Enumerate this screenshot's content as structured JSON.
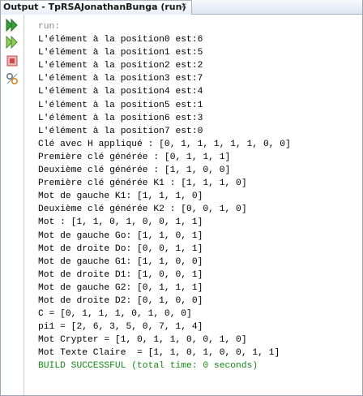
{
  "window": {
    "tab_title": "Output - TpRSAJonathanBunga (run)",
    "close_glyph": "×"
  },
  "toolbar": {
    "icons": [
      "rerun-icon",
      "rerun-with-options-icon",
      "stop-icon",
      "settings-icon"
    ],
    "colors": {
      "rerun": "#3aa23a",
      "stop": "#c94a4a"
    }
  },
  "console": {
    "lines": [
      {
        "text": "run:",
        "kind": "run"
      },
      {
        "text": "L'élément à la position0 est:6",
        "kind": "normal"
      },
      {
        "text": "L'élément à la position1 est:5",
        "kind": "normal"
      },
      {
        "text": "L'élément à la position2 est:2",
        "kind": "normal"
      },
      {
        "text": "L'élément à la position3 est:7",
        "kind": "normal"
      },
      {
        "text": "L'élément à la position4 est:4",
        "kind": "normal"
      },
      {
        "text": "L'élément à la position5 est:1",
        "kind": "normal"
      },
      {
        "text": "L'élément à la position6 est:3",
        "kind": "normal"
      },
      {
        "text": "L'élément à la position7 est:0",
        "kind": "normal"
      },
      {
        "text": "Clé avec H appliqué : [0, 1, 1, 1, 1, 1, 0, 0]",
        "kind": "normal"
      },
      {
        "text": "Première clé générée : [0, 1, 1, 1]",
        "kind": "normal"
      },
      {
        "text": "Deuxième clé générée : [1, 1, 0, 0]",
        "kind": "normal"
      },
      {
        "text": "Première clé générée K1 : [1, 1, 1, 0]",
        "kind": "normal"
      },
      {
        "text": "Mot de gauche K1: [1, 1, 1, 0]",
        "kind": "normal"
      },
      {
        "text": "Deuxième clé générée K2 : [0, 0, 1, 0]",
        "kind": "normal"
      },
      {
        "text": "Mot : [1, 1, 0, 1, 0, 0, 1, 1]",
        "kind": "normal"
      },
      {
        "text": "Mot de gauche Go: [1, 1, 0, 1]",
        "kind": "normal"
      },
      {
        "text": "Mot de droite Do: [0, 0, 1, 1]",
        "kind": "normal"
      },
      {
        "text": "Mot de gauche G1: [1, 1, 0, 0]",
        "kind": "normal"
      },
      {
        "text": "Mot de droite D1: [1, 0, 0, 1]",
        "kind": "normal"
      },
      {
        "text": "Mot de gauche G2: [0, 1, 1, 1]",
        "kind": "normal"
      },
      {
        "text": "Mot de droite D2: [0, 1, 0, 0]",
        "kind": "normal"
      },
      {
        "text": "C = [0, 1, 1, 1, 0, 1, 0, 0]",
        "kind": "normal"
      },
      {
        "text": "pi1 = [2, 6, 3, 5, 0, 7, 1, 4]",
        "kind": "normal"
      },
      {
        "text": "Mot Crypter = [1, 0, 1, 1, 0, 0, 1, 0]",
        "kind": "normal"
      },
      {
        "text": "Mot Texte Claire  = [1, 1, 0, 1, 0, 0, 1, 1]",
        "kind": "normal"
      },
      {
        "text": "BUILD SUCCESSFUL (total time: 0 seconds)",
        "kind": "build"
      }
    ]
  }
}
